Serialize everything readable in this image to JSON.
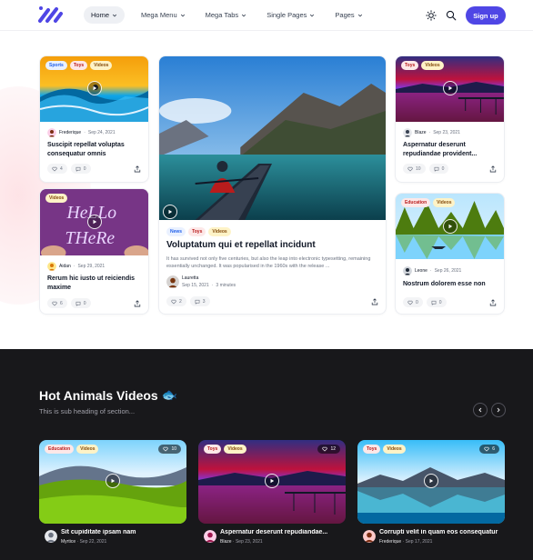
{
  "nav": {
    "items": [
      {
        "label": "Home"
      },
      {
        "label": "Mega Menu"
      },
      {
        "label": "Mega Tabs"
      },
      {
        "label": "Single Pages"
      },
      {
        "label": "Pages"
      }
    ],
    "signup_label": "Sign up"
  },
  "cards": {
    "c1": {
      "chips": [
        "Sports",
        "Toys",
        "Videos"
      ],
      "author": "Frederique",
      "date": "Sep 24, 2021",
      "title": "Suscipit repellat voluptas consequatur omnis",
      "likes": "4",
      "comments": "0"
    },
    "c2": {
      "chips": [
        "Videos"
      ],
      "author": "Aidan",
      "date": "Sep 29, 2021",
      "title": "Rerum hic iusto ut reiciendis maxime",
      "likes": "6",
      "comments": "0"
    },
    "big": {
      "chips": [
        "News",
        "Toys",
        "Videos"
      ],
      "title": "Voluptatum qui et repellat incidunt",
      "excerpt": "It has survived not only five centuries, but also the leap into electronic typesetting, remaining essentially unchanged. It was popularised in the 1960s with the release ...",
      "author": "Lauretta",
      "date": "Sep 15, 2021",
      "read_time": "3 minutes",
      "likes": "2",
      "comments": "3"
    },
    "c3": {
      "chips": [
        "Toys",
        "Videos"
      ],
      "author": "Blaze",
      "date": "Sep 23, 2021",
      "title": "Aspernatur deserunt repudiandae provident...",
      "likes": "10",
      "comments": "0"
    },
    "c4": {
      "chips": [
        "Education",
        "Videos"
      ],
      "author": "Leone",
      "date": "Sep 26, 2021",
      "title": "Nostrum dolorem esse non",
      "likes": "0",
      "comments": "0"
    }
  },
  "section": {
    "title": "Hot Animals Videos",
    "emoji": "🐟",
    "subtitle": "This is sub heading of section..."
  },
  "videos": [
    {
      "chips": [
        "Education",
        "Videos"
      ],
      "likes": "10",
      "title": "Sit cupiditate ipsam nam",
      "author": "Myrtice",
      "date": "Sep 22, 2021"
    },
    {
      "chips": [
        "Toys",
        "Videos"
      ],
      "likes": "12",
      "title": "Aspernatur deserunt repudiandae...",
      "author": "Blaze",
      "date": "Sep 23, 2021"
    },
    {
      "chips": [
        "Toys",
        "Videos"
      ],
      "likes": "6",
      "title": "Corrupti velit in quam eos consequatur",
      "author": "Frederique",
      "date": "Sep 17, 2021"
    }
  ],
  "colors": {
    "accent": "#4f46e5",
    "dark_bg": "#18181b"
  }
}
